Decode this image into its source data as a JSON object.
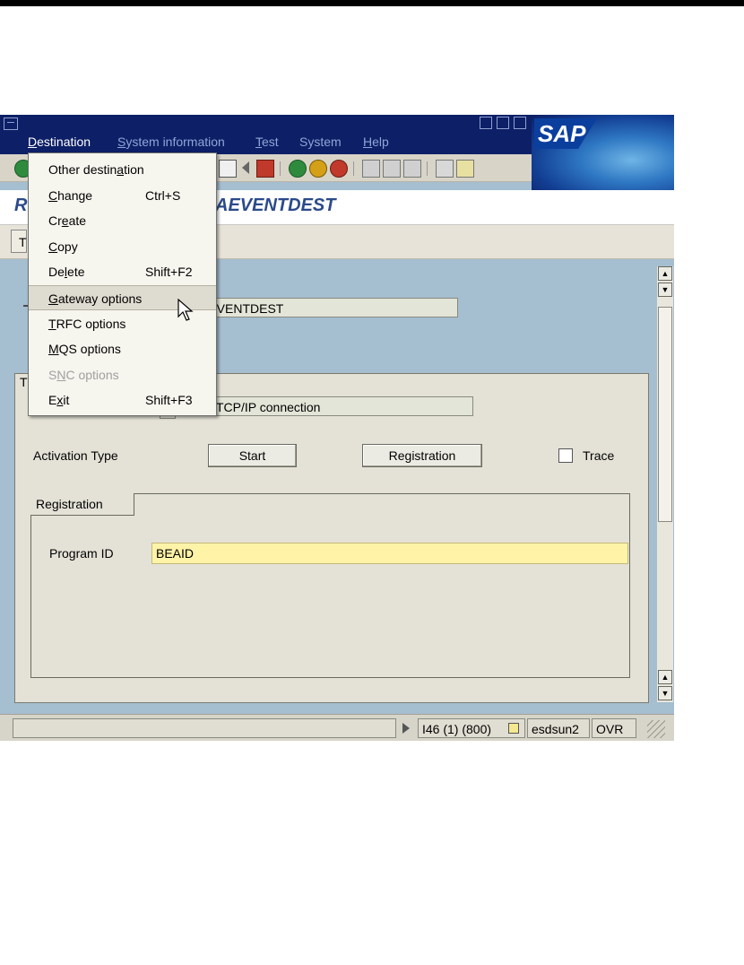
{
  "menubar": {
    "items": [
      {
        "label": "Destination",
        "ul": "D",
        "rest": "estination"
      },
      {
        "label": "System information",
        "ul": "S",
        "rest": "ystem information"
      },
      {
        "label": "Test",
        "ul": "T",
        "rest": "est"
      },
      {
        "label": "System",
        "ul": "",
        "rest": "System"
      },
      {
        "label": "Help",
        "ul": "H",
        "rest": "elp"
      }
    ]
  },
  "logo_text": "SAP",
  "title": {
    "prefix": "R",
    "suffix": "AEVENTDEST"
  },
  "app_toolbar": {
    "button_label": "T"
  },
  "fields": {
    "rfc_destination_value": "AEVENTDEST",
    "connection_type_value": "TCP/IP connection",
    "group_label_prefix": "T"
  },
  "activation": {
    "label": "Activation Type",
    "start_button": "Start",
    "registration_button": "Registration",
    "trace_label": "Trace",
    "trace_checked": false
  },
  "registration": {
    "tab_label": "Registration",
    "program_id_label": "Program ID",
    "program_id_value": "BEAID"
  },
  "statusbar": {
    "system": "I46 (1) (800)",
    "server": "esdsun2",
    "mode": "OVR"
  },
  "dropdown": {
    "items": [
      {
        "pre": "Other destin",
        "ul": "a",
        "post": "tion",
        "shortcut": "",
        "disabled": false,
        "highlight": false
      },
      {
        "pre": "",
        "ul": "C",
        "post": "hange",
        "shortcut": "Ctrl+S",
        "disabled": false,
        "highlight": false
      },
      {
        "pre": "Cr",
        "ul": "e",
        "post": "ate",
        "shortcut": "",
        "disabled": false,
        "highlight": false
      },
      {
        "pre": "",
        "ul": "C",
        "post": "opy",
        "shortcut": "",
        "disabled": false,
        "highlight": false
      },
      {
        "pre": "De",
        "ul": "l",
        "post": "ete",
        "shortcut": "Shift+F2",
        "disabled": false,
        "highlight": false
      },
      {
        "pre": "",
        "ul": "G",
        "post": "ateway options",
        "shortcut": "",
        "disabled": false,
        "highlight": true
      },
      {
        "pre": "",
        "ul": "T",
        "post": "RFC options",
        "shortcut": "",
        "disabled": false,
        "highlight": false
      },
      {
        "pre": "",
        "ul": "M",
        "post": "QS options",
        "shortcut": "",
        "disabled": false,
        "highlight": false
      },
      {
        "pre": "S",
        "ul": "N",
        "post": "C options",
        "shortcut": "",
        "disabled": true,
        "highlight": false
      },
      {
        "pre": "E",
        "ul": "x",
        "post": "it",
        "shortcut": "Shift+F3",
        "disabled": false,
        "highlight": false
      }
    ]
  },
  "colors": {
    "menubar_bg": "#0d1f66",
    "content_bg": "#a5bed0",
    "title_text": "#2b4a8b",
    "required_field_bg": "#fff3a8"
  }
}
